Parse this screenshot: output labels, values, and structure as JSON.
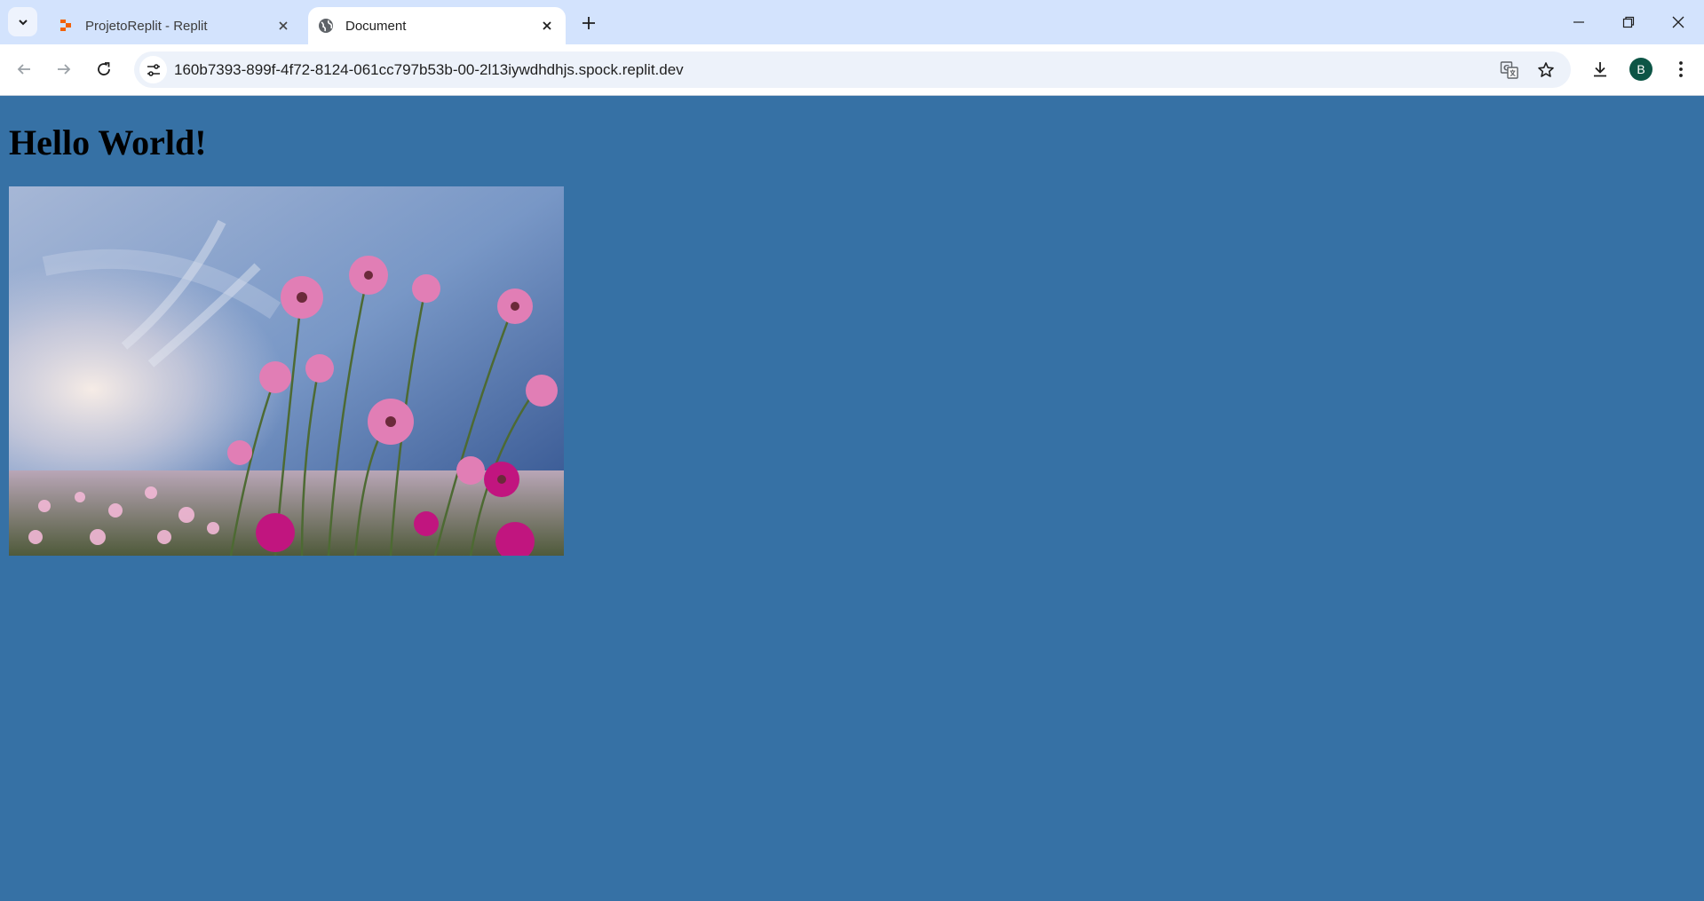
{
  "browser": {
    "tabs": [
      {
        "title": "ProjetoReplit - Replit",
        "active": false,
        "favicon": "replit-logo-icon"
      },
      {
        "title": "Document",
        "active": true,
        "favicon": "globe-icon"
      }
    ],
    "address_bar": {
      "url": "160b7393-899f-4f72-8124-061cc797b53b-00-2l13iywdhdhjs.spock.replit.dev"
    },
    "profile_initial": "B"
  },
  "page": {
    "heading": "Hello World!",
    "image": {
      "description_icon": "pink-cosmos-flowers-sky-photo"
    }
  },
  "colors": {
    "page_background": "#3671a5",
    "tabstrip_background": "#d3e3fd",
    "avatar": "#0d5546"
  }
}
